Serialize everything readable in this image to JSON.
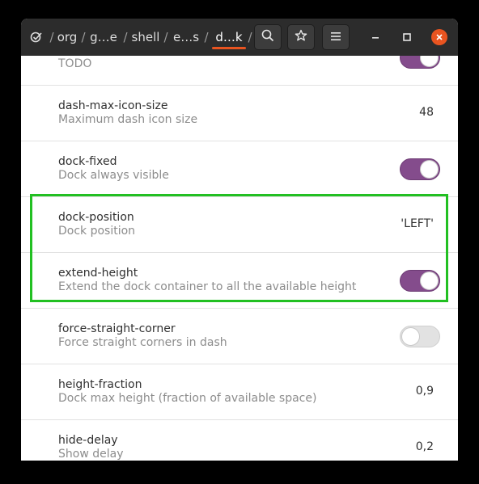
{
  "header": {
    "path_crumbs": [
      {
        "label": "org"
      },
      {
        "label": "g…e"
      },
      {
        "label": "shell"
      },
      {
        "label": "e…s"
      },
      {
        "label": "d…k"
      }
    ],
    "separator": "/",
    "icons": {
      "app": "dconf-check-icon",
      "search": "search-icon",
      "bookmark": "star-icon",
      "menu": "hamburger-menu-icon",
      "minimize": "minimize-icon",
      "maximize": "maximize-icon",
      "close": "close-icon"
    },
    "accent_color": "#e95420"
  },
  "rows": [
    {
      "name": "",
      "desc": "TODO",
      "type": "toggle",
      "state": true
    },
    {
      "name": "dash-max-icon-size",
      "desc": "Maximum dash icon size",
      "type": "value",
      "value": "48"
    },
    {
      "name": "dock-fixed",
      "desc": "Dock always visible",
      "type": "toggle",
      "state": true
    },
    {
      "name": "dock-position",
      "desc": "Dock position",
      "type": "value",
      "value": "'LEFT'"
    },
    {
      "name": "extend-height",
      "desc": "Extend the dock container to all the available height",
      "type": "toggle",
      "state": true
    },
    {
      "name": "force-straight-corner",
      "desc": "Force straight corners in dash",
      "type": "toggle",
      "state": false
    },
    {
      "name": "height-fraction",
      "desc": "Dock max height (fraction of available space)",
      "type": "value",
      "value": "0,9"
    },
    {
      "name": "hide-delay",
      "desc": "Show delay",
      "type": "value",
      "value": "0,2"
    }
  ],
  "colors": {
    "toggle_on": "#844c8c",
    "highlight": "#22c022"
  }
}
